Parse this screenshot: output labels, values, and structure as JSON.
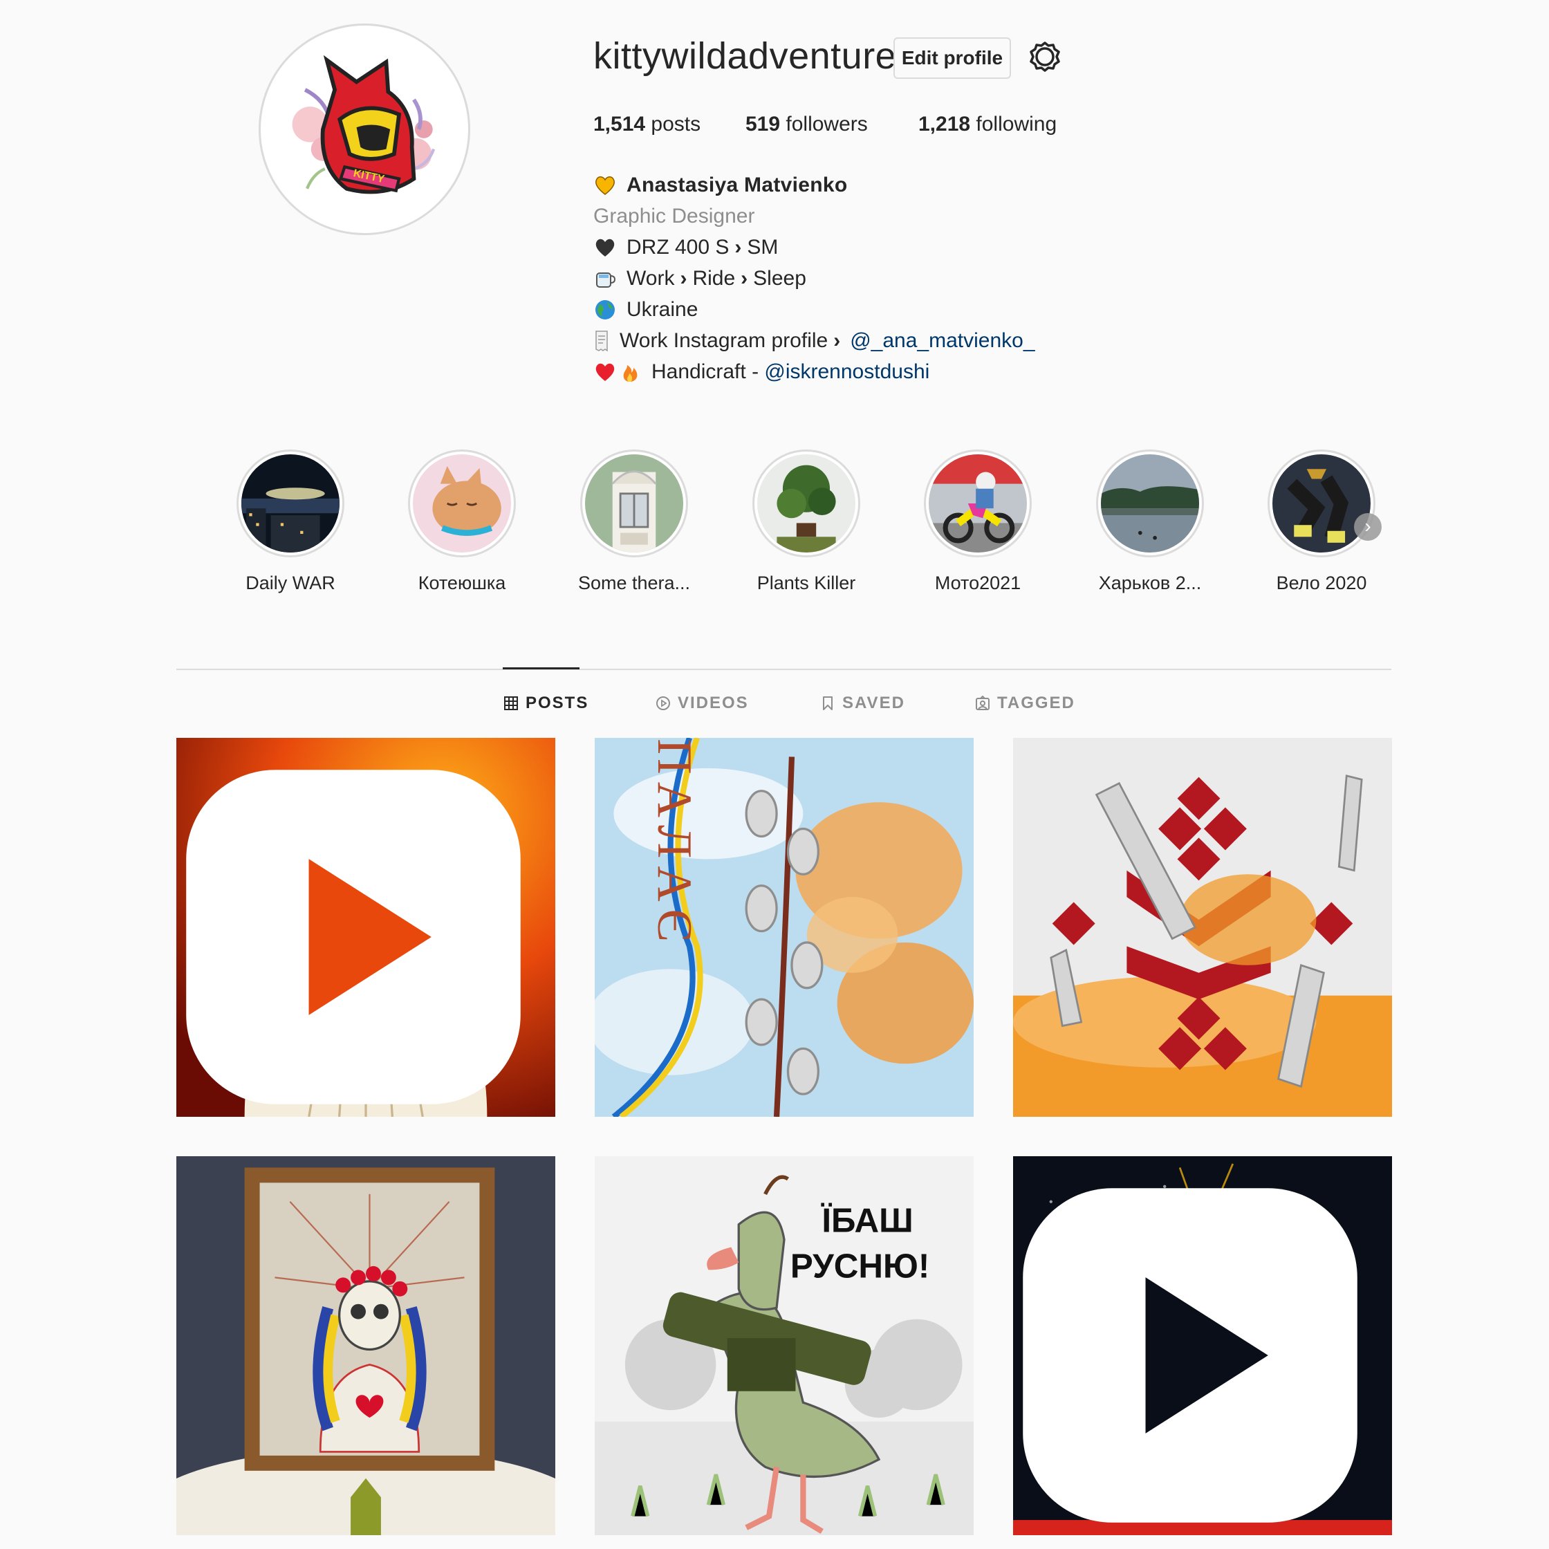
{
  "profile": {
    "username": "kittywildadventure",
    "edit_profile_label": "Edit profile",
    "stats": {
      "posts_count": "1,514",
      "posts_label": " posts",
      "followers_count": "519",
      "followers_label": " followers",
      "following_count": "1,218",
      "following_label": " following"
    },
    "bio": {
      "full_name": "Anastasiya Matvienko",
      "category": "Graphic Designer",
      "line1_a": "DRZ 400 S",
      "line1_b": "SM",
      "line2_a": "Work",
      "line2_b": "Ride",
      "line2_c": "Sleep",
      "line3": "Ukraine",
      "line4_text": "Work Instagram profile",
      "line4_link": "@_ana_matvienko_",
      "line5_text": "Handicraft - ",
      "line5_link": "@iskrennostdushi"
    }
  },
  "highlights": [
    {
      "label": "Daily WAR"
    },
    {
      "label": "Котеюшка"
    },
    {
      "label": "Some thera..."
    },
    {
      "label": "Plants Killer"
    },
    {
      "label": "Мото2021"
    },
    {
      "label": "Харьков 2..."
    },
    {
      "label": "Вело 2020"
    }
  ],
  "tabs": {
    "posts": "POSTS",
    "videos": "VIDEOS",
    "saved": "SAVED",
    "tagged": "TAGGED"
  },
  "posts": {
    "post2_text": "ПАЛАЄ",
    "post5_text_line1": "ЇБАШ",
    "post5_text_line2": "РУСНЮ!"
  },
  "colors": {
    "link": "#00376b",
    "muted": "#8e8e8e",
    "border": "#dbdbdb",
    "text": "#262626",
    "background": "#fafafa"
  },
  "icons": {
    "settings": "gear-icon",
    "posts_tab": "grid-icon",
    "videos_tab": "play-circle-icon",
    "saved_tab": "bookmark-icon",
    "tagged_tab": "tag-person-icon",
    "reel_marker": "play-icon",
    "highlight_next": "chevron-right-icon"
  }
}
